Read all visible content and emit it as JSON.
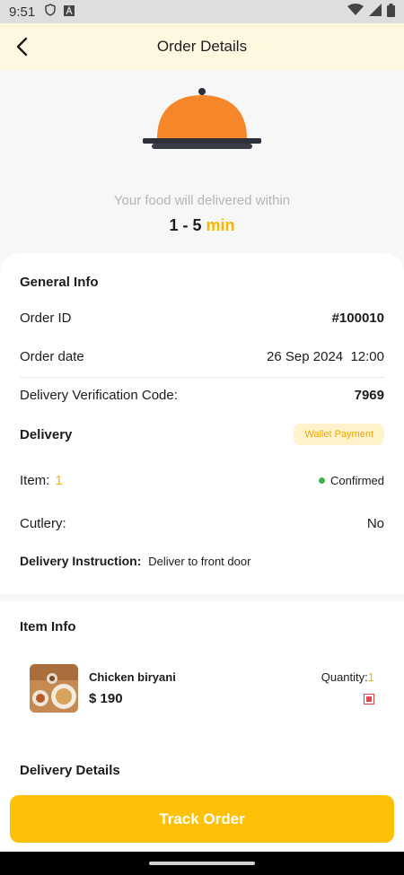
{
  "status_bar": {
    "time": "9:51"
  },
  "app_bar": {
    "title": "Order Details"
  },
  "hero": {
    "deliver_text": "Your food will delivered within",
    "time_range": "1 - 5",
    "time_unit": "min"
  },
  "general_info": {
    "title": "General Info",
    "order_id_label": "Order ID",
    "order_id_value": "#100010",
    "order_date_label": "Order date",
    "order_date_value": "26 Sep 2024  12:00",
    "verification_label": "Delivery Verification Code:",
    "verification_value": "7969",
    "delivery_label": "Delivery",
    "payment_badge": "Wallet Payment",
    "item_label": "Item:",
    "item_count": "1",
    "status": "Confirmed",
    "cutlery_label": "Cutlery:",
    "cutlery_value": "No",
    "instruction_label": "Delivery Instruction:",
    "instruction_value": "Deliver to front door"
  },
  "item_info": {
    "title": "Item Info",
    "item_name": "Chicken biryani",
    "item_price": "$ 190",
    "quantity_label": "Quantity:",
    "quantity_value": "1"
  },
  "delivery_details": {
    "title": "Delivery Details"
  },
  "track_button": {
    "label": "Track Order"
  },
  "colors": {
    "accent": "#ffc107",
    "cloche": "#f5862a",
    "status_green": "#3bb54a"
  }
}
